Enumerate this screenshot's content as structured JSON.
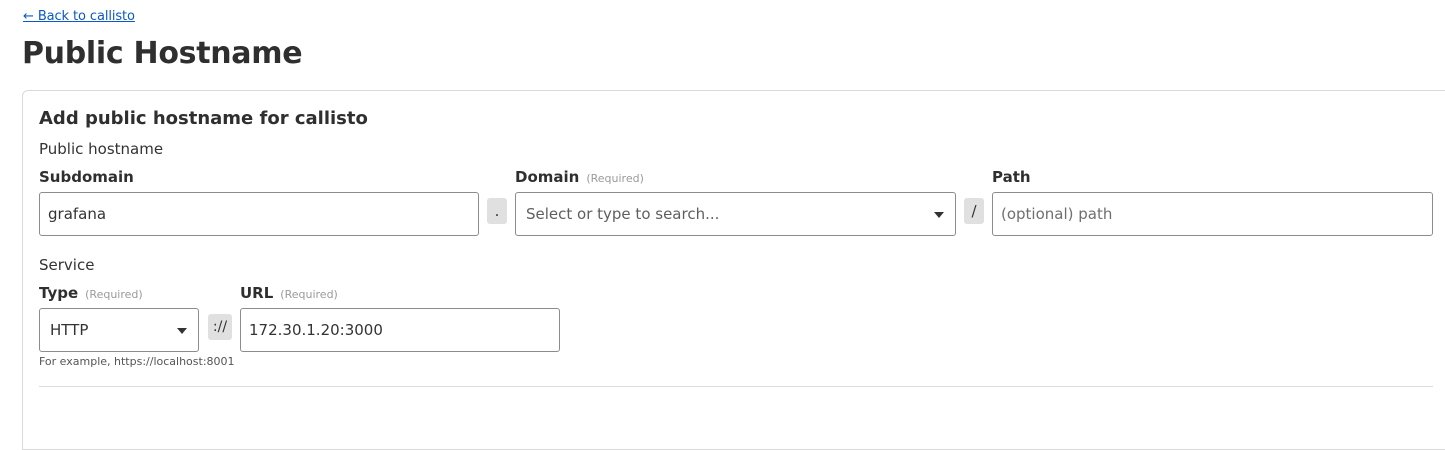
{
  "nav": {
    "back_label": "← Back to callisto"
  },
  "page": {
    "title": "Public Hostname"
  },
  "form": {
    "title": "Add public hostname for callisto",
    "public_hostname": {
      "section_label": "Public hostname",
      "subdomain": {
        "label": "Subdomain",
        "value": "grafana"
      },
      "dot": ".",
      "domain": {
        "label": "Domain",
        "required": "(Required)",
        "placeholder": "Select or type to search..."
      },
      "slash": "/",
      "path": {
        "label": "Path",
        "placeholder": "(optional) path",
        "value": ""
      }
    },
    "service": {
      "section_label": "Service",
      "type": {
        "label": "Type",
        "required": "(Required)",
        "value": "HTTP"
      },
      "scheme_sep": "://",
      "url": {
        "label": "URL",
        "required": "(Required)",
        "value": "172.30.1.20:3000"
      },
      "help": "For example, https://localhost:8001"
    }
  }
}
